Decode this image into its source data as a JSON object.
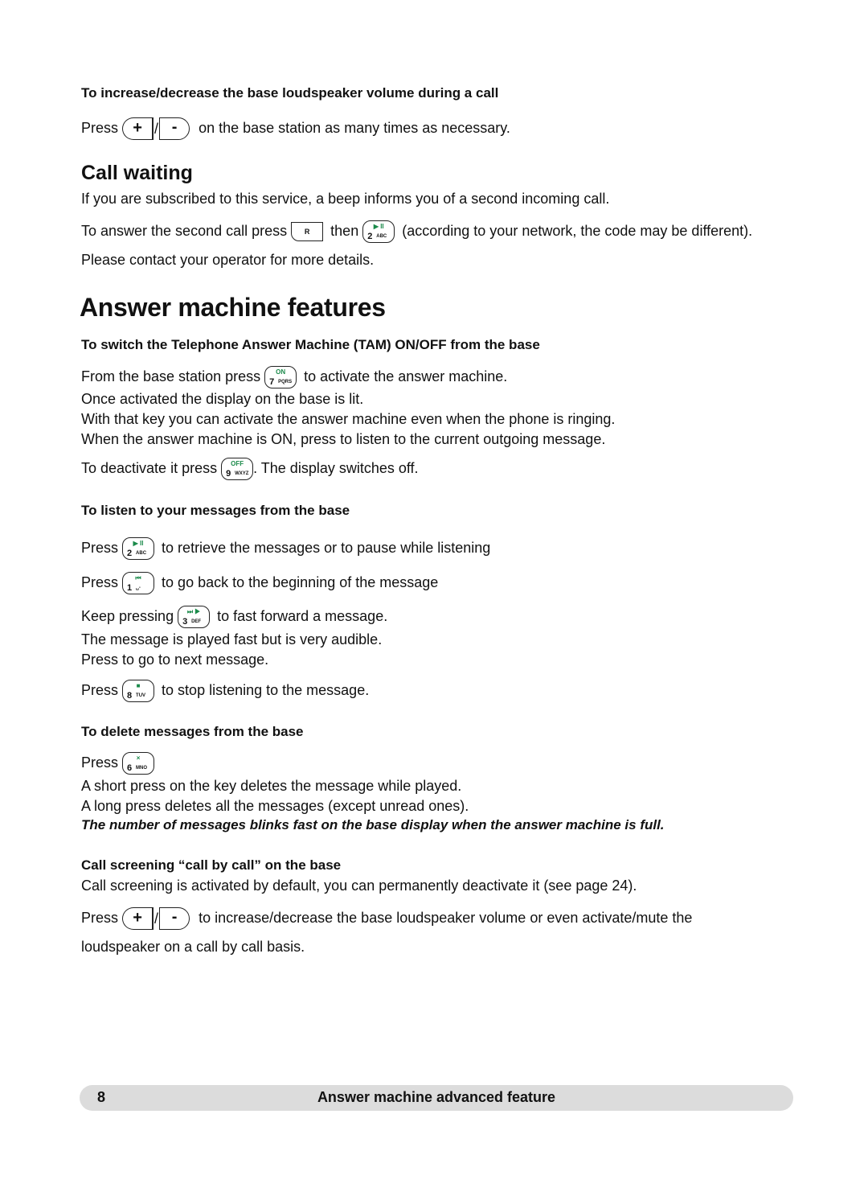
{
  "intro": {
    "heading": "To increase/decrease the base loudspeaker volume during a call",
    "press": "Press",
    "slash": "/",
    "text": "on the base station as many times as necessary."
  },
  "call_waiting": {
    "title": "Call waiting",
    "line1": "If you are subscribed to this service, a beep  informs you of a second incoming call.",
    "line2_a": "To answer the second call press",
    "line2_b": "then",
    "line2_c": "(according to your network, the code may be different).",
    "line3": "Please contact your operator for more details."
  },
  "answer_machine": {
    "title": "Answer machine features",
    "tam": {
      "heading": "To switch the Telephone Answer Machine (TAM) ON/OFF from the base",
      "line1_a": "From the base station press",
      "line1_b": "to activate the answer machine.",
      "line2": "Once activated the display on the base is lit.",
      "line3": "With that key you can activate the answer machine even when the phone is ringing.",
      "line4": "When the answer machine is ON, press to listen to the current outgoing message.",
      "line5_a": "To deactivate it press",
      "line5_b": ". The display switches off."
    },
    "listen": {
      "heading": "To listen to your messages from the base",
      "l1_a": "Press",
      "l1_b": "to retrieve the messages or to pause while listening",
      "l2_a": "Press",
      "l2_b": "to go back to the beginning of the message",
      "l3_a": "Keep pressing",
      "l3_b": "to fast forward a message.",
      "l4": "The message is played fast but is very audible.",
      "l5": "Press to go to next message.",
      "l6_a": "Press",
      "l6_b": "to stop listening to the message."
    },
    "delete": {
      "heading": "To delete messages from the base",
      "press": "Press",
      "l1": "A short press on the key deletes the message while played.",
      "l2": "A long press deletes all the messages (except unread ones).",
      "note": "The number of messages blinks fast on the base display when the answer machine is full."
    },
    "screening": {
      "heading": "Call screening “call by call” on the base",
      "l1": "Call screening is activated by default, you can permanently deactivate it (see page 24).",
      "press": "Press",
      "slash": "/",
      "l2": "to increase/decrease the base loudspeaker volume or even activate/mute the",
      "l3": "loudspeaker on a call by call basis."
    }
  },
  "keys": {
    "plus": "+",
    "minus": "-",
    "r": "R",
    "k2": {
      "sym": "▶ II",
      "digit": "2",
      "letters": "ABC"
    },
    "k7": {
      "sym": "ON",
      "digit": "7",
      "letters": "PQRS"
    },
    "k9": {
      "sym": "OFF",
      "digit": "9",
      "letters": "WXYZ"
    },
    "k1": {
      "sym": "⏮",
      "digit": "1",
      "letters": "␣-"
    },
    "k3": {
      "sym": "⏭ ▶",
      "digit": "3",
      "letters": "DEF"
    },
    "k8": {
      "sym": "■",
      "digit": "8",
      "letters": "TUV"
    },
    "k6": {
      "sym": "×",
      "digit": "6",
      "letters": "MNO"
    }
  },
  "footer": {
    "page_number": "8",
    "title": "Answer machine advanced feature"
  }
}
